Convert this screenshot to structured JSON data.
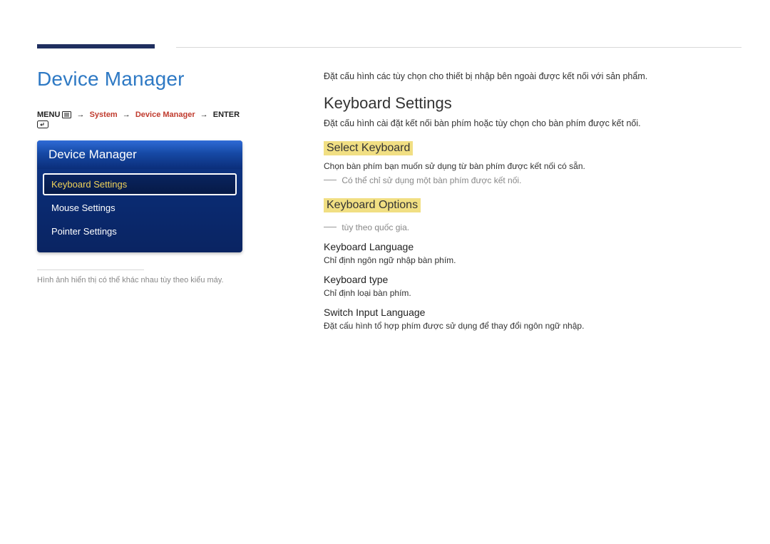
{
  "left": {
    "page_title": "Device Manager",
    "breadcrumb": {
      "menu_label": "MENU",
      "items": [
        "System",
        "Device Manager"
      ],
      "enter_label": "ENTER"
    },
    "osd": {
      "header": "Device Manager",
      "items": [
        {
          "label": "Keyboard Settings",
          "selected": true
        },
        {
          "label": "Mouse Settings",
          "selected": false
        },
        {
          "label": "Pointer Settings",
          "selected": false
        }
      ]
    },
    "note": "Hình ảnh hiển thị có thể khác nhau tùy theo kiểu máy."
  },
  "right": {
    "intro": "Đặt cấu hình các tùy chọn cho thiết bị nhập bên ngoài được kết nối với sản phẩm.",
    "heading": "Keyboard Settings",
    "heading_desc": "Đặt cấu hình cài đặt kết nối bàn phím hoặc tùy chọn cho bàn phím được kết nối.",
    "select_keyboard": {
      "title": "Select Keyboard",
      "desc": "Chọn bàn phím bạn muốn sử dụng từ bàn phím được kết nối có sẵn.",
      "note": "Có thể chỉ sử dụng một bàn phím được kết nối."
    },
    "keyboard_options": {
      "title": "Keyboard Options",
      "note": "tùy theo quốc gia.",
      "items": [
        {
          "label": "Keyboard Language",
          "desc": "Chỉ định ngôn ngữ nhập bàn phím."
        },
        {
          "label": "Keyboard type",
          "desc": "Chỉ định loại bàn phím."
        },
        {
          "label": "Switch Input Language",
          "desc": "Đặt cấu hình tổ hợp phím được sử dụng để thay đổi ngôn ngữ nhập."
        }
      ]
    }
  }
}
